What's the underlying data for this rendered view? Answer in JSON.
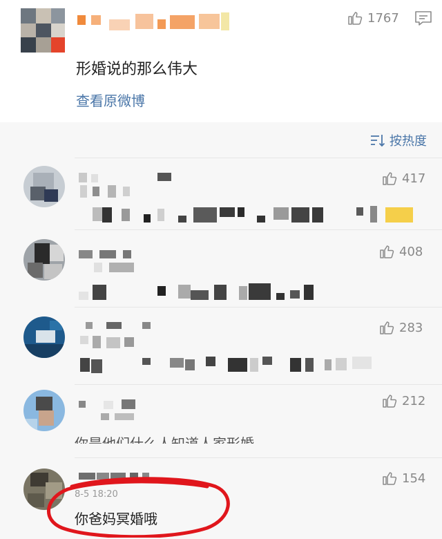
{
  "main_post": {
    "text": "形婚说的那么伟大",
    "view_original_label": "查看原微博",
    "likes": "1767",
    "icons": {
      "like": "thumbs-up-icon",
      "comment": "comment-icon"
    }
  },
  "sort": {
    "label": "按热度",
    "icon": "sort-icon"
  },
  "comments": [
    {
      "likes": "417"
    },
    {
      "likes": "408"
    },
    {
      "likes": "283"
    },
    {
      "likes": "212",
      "partial_text": "你是他们什么人知道人家形婚"
    },
    {
      "likes": "154",
      "time": "8-5 18:20",
      "text": "你爸妈冥婚哦"
    }
  ],
  "colors": {
    "link": "#4a76a8",
    "annotation": "#e0161c",
    "background": "#f7f7f7"
  }
}
